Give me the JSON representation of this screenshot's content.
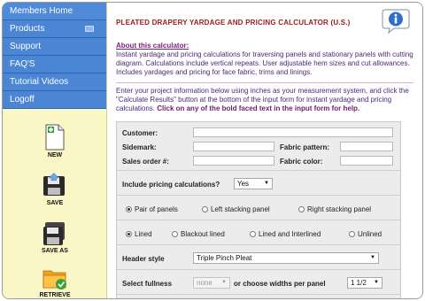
{
  "sidebar": {
    "nav": [
      {
        "label": "Members Home"
      },
      {
        "label": "Products"
      },
      {
        "label": "Support"
      },
      {
        "label": "FAQ'S"
      },
      {
        "label": "Tutorial Videos"
      },
      {
        "label": "Logoff"
      }
    ],
    "tools": [
      {
        "label": "NEW",
        "icon": "new-document-icon"
      },
      {
        "label": "SAVE",
        "icon": "save-floppy-icon"
      },
      {
        "label": "SAVE AS",
        "icon": "save-as-floppy-icon"
      },
      {
        "label": "RETRIEVE",
        "icon": "retrieve-folder-icon"
      }
    ]
  },
  "header": {
    "title": "PLEATED DRAPERY YARDAGE AND PRICING CALCULATOR (U.S.)",
    "info_icon": "info-icon"
  },
  "about": {
    "link": "About this calculator:",
    "text": "Instant yardage and pricing calculations for traversing panels and stationary panels with cutting diagram. Calculations include vertical repeats. User adjustable hem sizes and cut allowances. Includes yardages and pricing for face fabric, trims and linings."
  },
  "instructions": {
    "text": "Enter your project information below using inches as your measurement system, and click the \"Calculate Results\" button at the bottom of the input form for instant yardage and pricing calculations.",
    "bold": "Click on any of the bold faced text in the input form for help."
  },
  "form": {
    "customer_label": "Customer:",
    "customer_value": "",
    "sidemark_label": "Sidemark:",
    "sidemark_value": "",
    "fabric_pattern_label": "Fabric pattern:",
    "fabric_pattern_value": "",
    "sales_order_label": "Sales order #:",
    "sales_order_value": "",
    "fabric_color_label": "Fabric color:",
    "fabric_color_value": "",
    "pricing_label": "Include pricing calculations?",
    "pricing_value": "Yes",
    "panel_options": [
      "Pair of panels",
      "Left stacking panel",
      "Right stacking panel"
    ],
    "panel_selected": "Pair of panels",
    "lining_options": [
      "Lined",
      "Blackout lined",
      "Lined and Interlined",
      "Unlined"
    ],
    "lining_selected": "Lined",
    "header_style_label": "Header style",
    "header_style_value": "Triple Pinch Pleat",
    "fullness_label": "Select fullness",
    "fullness_value": "none",
    "widths_label": "or choose widths per panel",
    "widths_value": "1 1/2"
  }
}
